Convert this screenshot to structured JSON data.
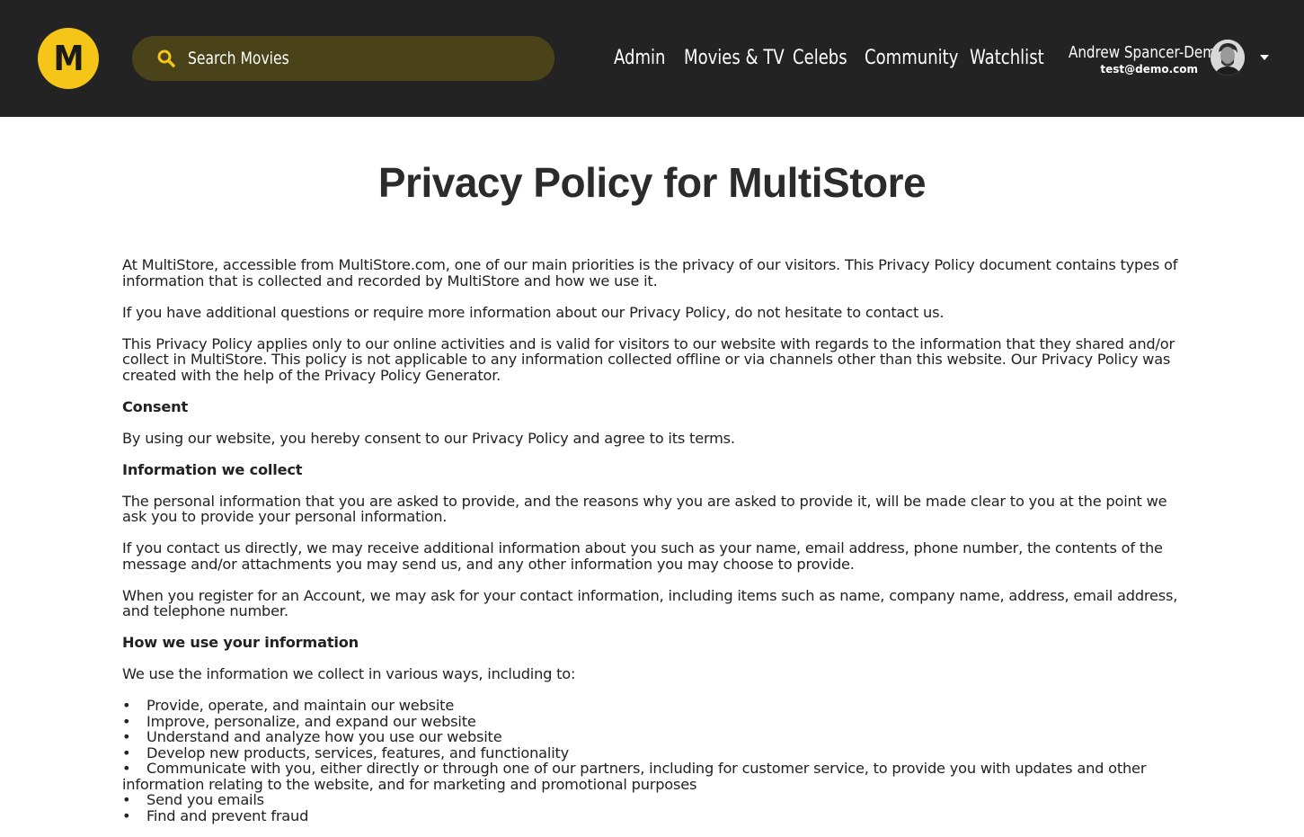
{
  "header": {
    "logo_letter": "M",
    "search_placeholder": "Search Movies",
    "nav": [
      "Admin",
      "Movies & TV",
      "Celebs",
      "Community",
      "Watchlist"
    ],
    "user": {
      "name": "Andrew Spancer-Demo",
      "email": "test@demo.com"
    },
    "colors": {
      "bar": "#232323",
      "accent": "#f5c518",
      "search_bg": "#4a4219"
    }
  },
  "page": {
    "title": "Privacy Policy for MultiStore",
    "intro_1": "At MultiStore, accessible from MultiStore.com, one of our main priorities is the privacy of our visitors. This Privacy Policy document contains types of information that is collected and recorded by MultiStore and how we use it.",
    "intro_2": "If you have additional questions or require more information about our Privacy Policy, do not hesitate to contact us.",
    "intro_3": "This Privacy Policy applies only to our online activities and is valid for visitors to our website with regards to the information that they shared and/or collect in MultiStore. This policy is not applicable to any information collected offline or via channels other than this website. Our Privacy Policy was created with the help of the Privacy Policy Generator.",
    "consent_heading": "Consent",
    "consent_text": "By using our website, you hereby consent to our Privacy Policy and agree to its terms.",
    "collect_heading": "Information we collect",
    "collect_1": "The personal information that you are asked to provide, and the reasons why you are asked to provide it, will be made clear to you at the point we ask you to provide your personal information.",
    "collect_2": "If you contact us directly, we may receive additional information about you such as your name, email address, phone number, the contents of the message and/or attachments you may send us, and any other information you may choose to provide.",
    "collect_3": "When you register for an Account, we may ask for your contact information, including items such as name, company name, address, email address, and telephone number.",
    "use_heading": "How we use your information",
    "use_intro": "We use the information we collect in various ways, including to:",
    "use_list": [
      "Provide, operate, and maintain our website",
      "Improve, personalize, and expand our website",
      "Understand and analyze how you use our website",
      "Develop new products, services, features, and functionality",
      "Communicate with you, either directly or through one of our partners, including for customer service, to provide you with updates and other information relating to the website, and for marketing and promotional purposes",
      "Send you emails",
      "Find and prevent fraud"
    ]
  }
}
